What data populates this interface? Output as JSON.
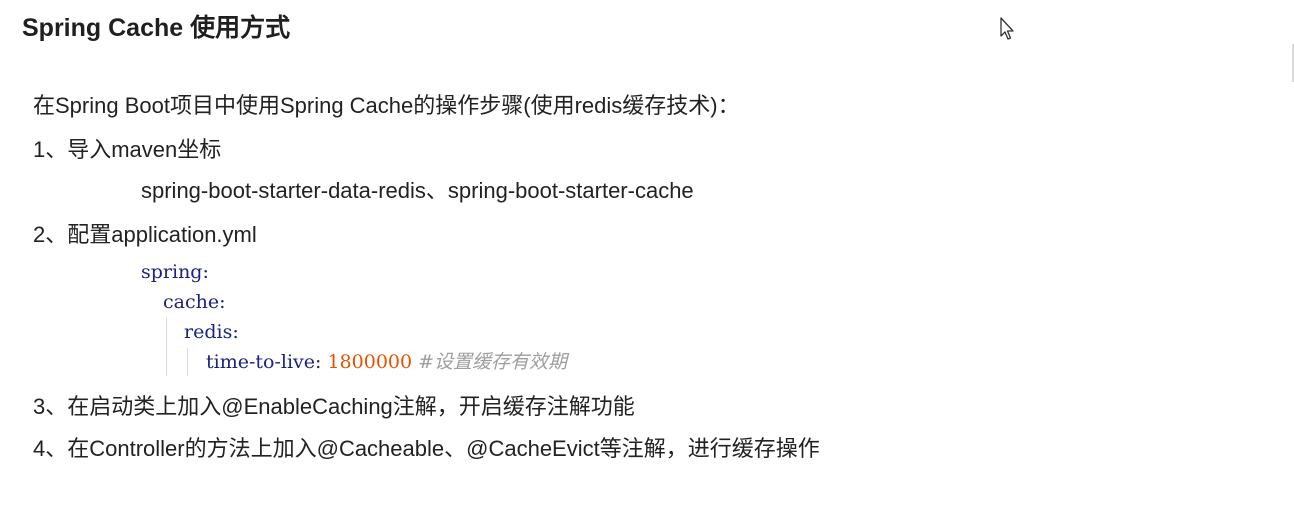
{
  "title": "Spring Cache 使用方式",
  "intro": "在Spring Boot项目中使用Spring Cache的操作步骤(使用redis缓存技术)：",
  "steps": {
    "step1": "1、导入maven坐标",
    "dependencies": "spring-boot-starter-data-redis、spring-boot-starter-cache",
    "step2": "2、配置application.yml",
    "step3": "3、在启动类上加入@EnableCaching注解，开启缓存注解功能",
    "step4": "4、在Controller的方法上加入@Cacheable、@CacheEvict等注解，进行缓存操作"
  },
  "yaml": {
    "spring": "spring:",
    "cache": "cache:",
    "redis": "redis:",
    "ttl_key": "time-to-live: ",
    "ttl_value": "1800000",
    "ttl_comment": " #设置缓存有效期"
  },
  "colors": {
    "yaml_key": "#1a237e",
    "yaml_number": "#e65100",
    "yaml_comment": "#9e9e9e"
  },
  "icons": {
    "cursor": "mouse-pointer-icon"
  }
}
